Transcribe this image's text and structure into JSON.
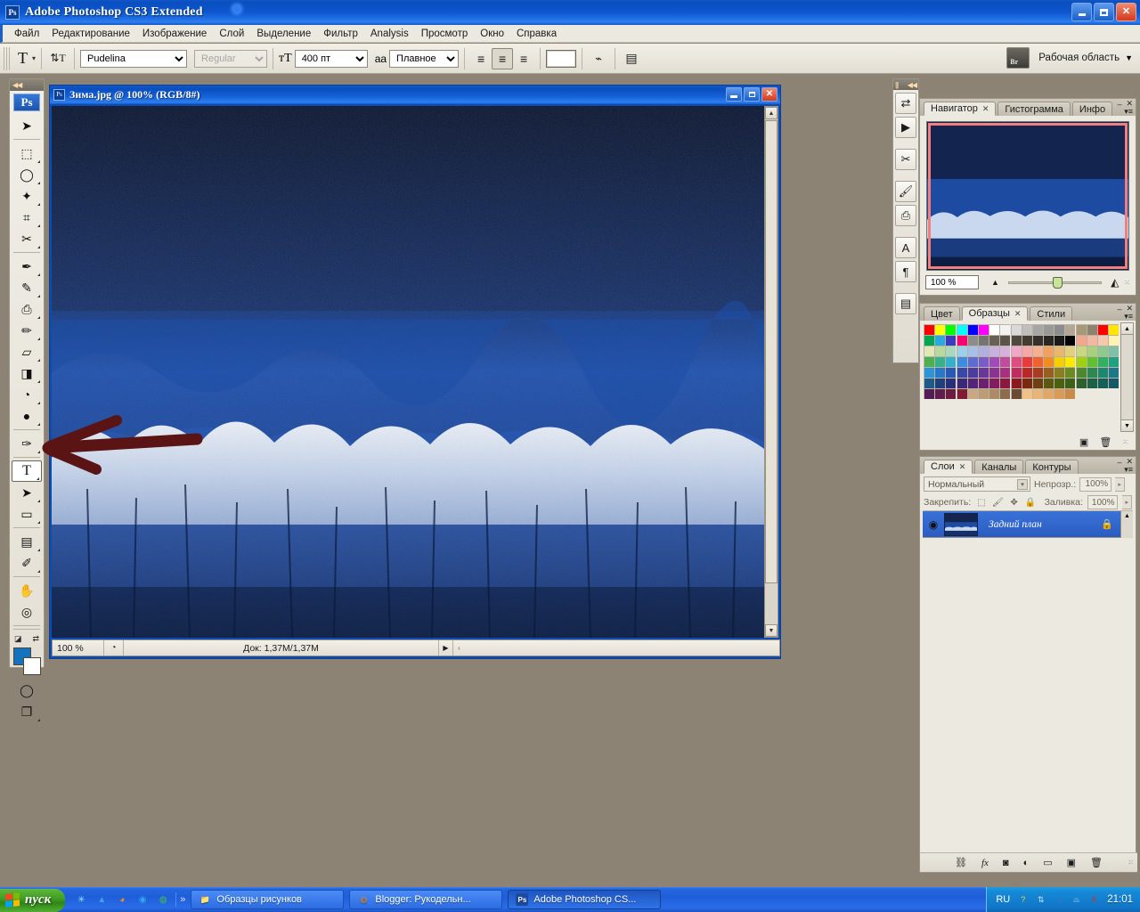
{
  "app": {
    "title": "Adobe Photoshop CS3 Extended",
    "badge": "Ps",
    "min": "_",
    "max": "□",
    "close": "✕"
  },
  "menubar": {
    "items": [
      "Файл",
      "Редактирование",
      "Изображение",
      "Слой",
      "Выделение",
      "Фильтр",
      "Analysis",
      "Просмотр",
      "Окно",
      "Справка"
    ]
  },
  "options": {
    "tool_icon": "T",
    "tool_caret": "▾",
    "orientation_icon": "⇅T",
    "font_family": "Pudelina",
    "font_style": "Regular",
    "size_icon": "ᴛT",
    "font_size": "400 пт",
    "aa_icon": "aa",
    "antialias": "Плавное",
    "align_left": "≡",
    "align_center": "≡",
    "align_right": "≡",
    "color_label": "",
    "warp_icon": "⌁",
    "palette_icon": "▤",
    "bridge_icon": "Br",
    "workspace_label": "Рабочая область",
    "workspace_caret": "▼"
  },
  "toolbox": {
    "logo": "Ps",
    "collapse_icon": "◀◀",
    "tools": [
      {
        "name": "move-tool",
        "glyph": "➤",
        "sub": false
      },
      {
        "name": "marquee-tool",
        "glyph": "⬚",
        "sub": true
      },
      {
        "name": "lasso-tool",
        "glyph": "◯",
        "sub": true
      },
      {
        "name": "magic-wand-tool",
        "glyph": "✦",
        "sub": true
      },
      {
        "name": "crop-tool",
        "glyph": "⌗",
        "sub": true
      },
      {
        "name": "slice-tool",
        "glyph": "✂",
        "sub": true
      },
      {
        "name": "healing-brush-tool",
        "glyph": "✒",
        "sub": true
      },
      {
        "name": "brush-tool",
        "glyph": "✎",
        "sub": true
      },
      {
        "name": "clone-stamp-tool",
        "glyph": "⎙",
        "sub": true
      },
      {
        "name": "history-brush-tool",
        "glyph": "✏",
        "sub": true
      },
      {
        "name": "eraser-tool",
        "glyph": "▱",
        "sub": true
      },
      {
        "name": "gradient-tool",
        "glyph": "◨",
        "sub": true
      },
      {
        "name": "blur-tool",
        "glyph": "◔",
        "sub": true
      },
      {
        "name": "dodge-tool",
        "glyph": "●",
        "sub": true
      },
      {
        "name": "pen-tool",
        "glyph": "✑",
        "sub": true
      },
      {
        "name": "type-tool",
        "glyph": "T",
        "sub": true,
        "selected": true
      },
      {
        "name": "path-selection-tool",
        "glyph": "➤",
        "sub": true
      },
      {
        "name": "rectangle-tool",
        "glyph": "▭",
        "sub": true
      },
      {
        "name": "notes-tool",
        "glyph": "▤",
        "sub": true
      },
      {
        "name": "eyedropper-tool",
        "glyph": "✐",
        "sub": true
      },
      {
        "name": "hand-tool",
        "glyph": "✋",
        "sub": false
      },
      {
        "name": "zoom-tool",
        "glyph": "◎",
        "sub": false
      }
    ],
    "foreground_color": "#1573be",
    "background_color": "#ffffff",
    "default_colors_icon": "◪",
    "swap_colors_icon": "⇄",
    "quickmask_icon": "◯",
    "screenmode_icon": "❐"
  },
  "document": {
    "icon": "Ps",
    "title": "Зима.jpg @ 100% (RGB/8#)",
    "min": "_",
    "max": "□",
    "close": "✕",
    "status": {
      "zoom": "100 %",
      "preview_icon": "◔",
      "doc_size": "Док: 1,37M/1,37M",
      "arrow": "▶",
      "grip": "‹"
    }
  },
  "dockstrip": {
    "collapse_icon": "◀◀",
    "buttons": [
      {
        "name": "bridge-dock-icon",
        "glyph": "⇄"
      },
      {
        "name": "animation-dock-icon",
        "glyph": "▶"
      },
      {
        "name": "tool-presets-dock-icon",
        "glyph": "✂"
      },
      {
        "name": "brushes-dock-icon",
        "glyph": "🖌"
      },
      {
        "name": "clone-source-dock-icon",
        "glyph": "⎙"
      },
      {
        "name": "character-dock-icon",
        "glyph": "A"
      },
      {
        "name": "paragraph-dock-icon",
        "glyph": "¶"
      },
      {
        "name": "layer-comps-dock-icon",
        "glyph": "▤"
      }
    ]
  },
  "navigator": {
    "tabs": [
      {
        "label": "Навигатор",
        "active": true,
        "closable": true
      },
      {
        "label": "Гистограмма",
        "active": false,
        "closable": false
      },
      {
        "label": "Инфо",
        "active": false,
        "closable": false
      }
    ],
    "minimize": "–",
    "close": "✕",
    "menu": "▾≡",
    "zoom_value": "100 %",
    "zoom_out_icon": "▲",
    "zoom_in_icon": "◭",
    "resize_grip": "⁙"
  },
  "swatches": {
    "tabs": [
      {
        "label": "Цвет",
        "active": false,
        "closable": false
      },
      {
        "label": "Образцы",
        "active": true,
        "closable": true
      },
      {
        "label": "Стили",
        "active": false,
        "closable": false
      }
    ],
    "minimize": "–",
    "close": "✕",
    "menu": "▾≡",
    "new_swatch_icon": "▣",
    "delete_icon": "🗑",
    "resize_grip": "⁙",
    "scroll_up": "▲",
    "scroll_down": "▼",
    "colors": [
      "#ff0000",
      "#ffff00",
      "#00ff00",
      "#00ffff",
      "#0000ff",
      "#ff00ff",
      "#ffffff",
      "#f2f2f2",
      "#d9d9d9",
      "#bfbfbf",
      "#a6a6a6",
      "#999999",
      "#8c8c8c",
      "#b3a894",
      "#a89878",
      "#8c8470",
      "#ff0000",
      "#ffe600",
      "#00a650",
      "#2ba8e0",
      "#3b3bbf",
      "#ff0073",
      "#8c8c8c",
      "#757575",
      "#666055",
      "#5c5449",
      "#4f483e",
      "#423c33",
      "#36302a",
      "#2b2622",
      "#1a1a1a",
      "#000000",
      "#f2a88c",
      "#f2b8a0",
      "#f5c8b0",
      "#fff2b3",
      "#e0e8b8",
      "#b8d9a0",
      "#a8d8c0",
      "#9cd0e8",
      "#a8c0e8",
      "#b0b0e0",
      "#c8b0e0",
      "#d8b0dc",
      "#f0a8c8",
      "#f5a8a8",
      "#f5b090",
      "#f0a060",
      "#e8b870",
      "#e0d080",
      "#c8d880",
      "#a8d080",
      "#90c890",
      "#80c0a8",
      "#4caf50",
      "#38b08c",
      "#34b0c8",
      "#3c8ce0",
      "#5c6cd0",
      "#7a5cc8",
      "#a04cb8",
      "#c04ca0",
      "#e04c80",
      "#e83c3c",
      "#f06030",
      "#f08c20",
      "#f5d000",
      "#ffe800",
      "#a0d010",
      "#60c030",
      "#30b060",
      "#20a080",
      "#2896d8",
      "#2878c8",
      "#2858b8",
      "#3848a8",
      "#4c3ca0",
      "#683898",
      "#883490",
      "#a83080",
      "#c02c60",
      "#b82828",
      "#a83c20",
      "#986020",
      "#888020",
      "#6c8820",
      "#4c8830",
      "#2c8850",
      "#1c8870",
      "#1c7888",
      "#1c5c88",
      "#20407c",
      "#28307c",
      "#3c2878",
      "#542478",
      "#6c2070",
      "#841c60",
      "#8c1840",
      "#8c1820",
      "#7c2810",
      "#6c4010",
      "#5c5810",
      "#4c6010",
      "#3c6018",
      "#2c6030",
      "#1c6048",
      "#146058",
      "#145868",
      "#541c54",
      "#601c4c",
      "#6c1c40",
      "#801c34",
      "#c8a884",
      "#bc9c74",
      "#ac8c64",
      "#8c6c4c",
      "#6c4c30",
      "#f0c088",
      "#e8b478",
      "#e0a868",
      "#d89c58",
      "#c88c48",
      "",
      "",
      "",
      "",
      ""
    ]
  },
  "layers": {
    "tabs": [
      {
        "label": "Слои",
        "active": true,
        "closable": true
      },
      {
        "label": "Каналы",
        "active": false,
        "closable": false
      },
      {
        "label": "Контуры",
        "active": false,
        "closable": false
      }
    ],
    "minimize": "–",
    "close": "✕",
    "menu": "▾≡",
    "blend_mode": "Нормальный",
    "blend_caret": "▾",
    "opacity_label": "Непрозр.:",
    "opacity_value": "100%",
    "opacity_caret": "▸",
    "lock_label": "Закрепить:",
    "lock_icons": [
      "⬚",
      "🖌",
      "✥",
      "🔒"
    ],
    "fill_label": "Заливка:",
    "fill_value": "100%",
    "fill_caret": "▸",
    "rows": [
      {
        "eye": "◉",
        "name": "Задний план",
        "locked": "🔒",
        "selected": true
      }
    ],
    "scroll_up": "▲",
    "footer_icons": [
      {
        "name": "link-layers-icon",
        "glyph": "⛓"
      },
      {
        "name": "layer-style-icon",
        "glyph": "fx"
      },
      {
        "name": "layer-mask-icon",
        "glyph": "◙"
      },
      {
        "name": "adjustment-layer-icon",
        "glyph": "◐"
      },
      {
        "name": "new-group-icon",
        "glyph": "▭"
      },
      {
        "name": "new-layer-icon",
        "glyph": "▣"
      },
      {
        "name": "delete-layer-icon",
        "glyph": "🗑"
      }
    ],
    "resize_grip": "⁙"
  },
  "taskbar": {
    "start_label": "пуск",
    "quicklaunch": [
      {
        "name": "ql-sparkle-icon",
        "glyph": "✳",
        "color": "#8fe0f5"
      },
      {
        "name": "ql-triangle-icon",
        "glyph": "▲",
        "color": "#4a9fe0"
      },
      {
        "name": "ql-firefox-icon",
        "glyph": "◕",
        "color": "#f08a20"
      },
      {
        "name": "ql-ie-icon",
        "glyph": "◉",
        "color": "#2fa8e8"
      },
      {
        "name": "ql-chrome-icon",
        "glyph": "◍",
        "color": "#4ac04a"
      }
    ],
    "more_chevron": "»",
    "items": [
      {
        "name": "taskbar-item-folder",
        "icon": "📁",
        "icon_color": "#ffc84a",
        "label": "Образцы рисунков",
        "active": false
      },
      {
        "name": "taskbar-item-blogger",
        "icon": "◍",
        "icon_color": "#f08a20",
        "label": "Blogger: Рукодельн...",
        "active": false
      },
      {
        "name": "taskbar-item-photoshop",
        "icon": "Ps",
        "icon_color": "#2a5fb8",
        "label": "Adobe Photoshop CS...",
        "active": true
      }
    ],
    "tray": {
      "language": "RU",
      "icons": [
        {
          "name": "tray-help-icon",
          "glyph": "?",
          "color": "#e8e020"
        },
        {
          "name": "tray-network-icon",
          "glyph": "⇅",
          "color": "#cfe6ff"
        },
        {
          "name": "tray-volume-icon",
          "glyph": "◀",
          "color": "#2a78c8"
        },
        {
          "name": "tray-safely-remove-icon",
          "glyph": "⏏",
          "color": "#4a96e0"
        },
        {
          "name": "tray-antivirus-icon",
          "glyph": "K",
          "color": "#d03020"
        }
      ],
      "clock": "21:01"
    }
  },
  "annotation": {
    "arrow_color": "#5a1414",
    "description": "hand-drawn-arrow-pointing-to-type-tool"
  },
  "photo": {
    "sky_color": "#0d1f47",
    "forest_color": "#1b4a9c",
    "snow_color": "#dde6f5"
  }
}
